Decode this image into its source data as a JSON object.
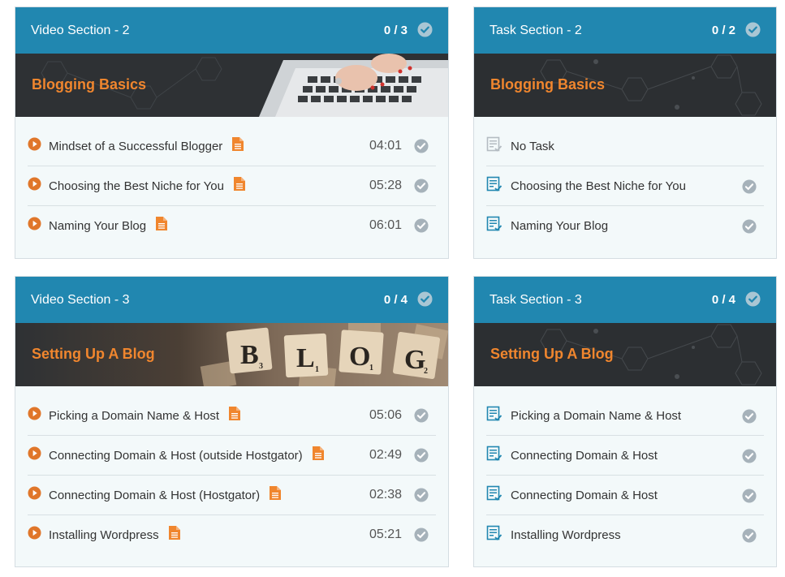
{
  "video_sections": [
    {
      "header_title": "Video Section - 2",
      "progress": "0 / 3",
      "banner_title": "Blogging Basics",
      "lessons": [
        {
          "title": "Mindset of a Successful Blogger",
          "duration": "04:01"
        },
        {
          "title": "Choosing the Best Niche for You",
          "duration": "05:28"
        },
        {
          "title": "Naming Your Blog",
          "duration": "06:01"
        }
      ]
    },
    {
      "header_title": "Video Section - 3",
      "progress": "0 / 4",
      "banner_title": "Setting Up A Blog",
      "lessons": [
        {
          "title": "Picking a Domain Name & Host",
          "duration": "05:06"
        },
        {
          "title": "Connecting Domain & Host (outside Hostgator)",
          "duration": "02:49"
        },
        {
          "title": "Connecting Domain & Host (Hostgator)",
          "duration": "02:38"
        },
        {
          "title": "Installing Wordpress",
          "duration": "05:21"
        }
      ]
    }
  ],
  "task_sections": [
    {
      "header_title": "Task Section - 2",
      "progress": "0 / 2",
      "banner_title": "Blogging Basics",
      "tasks": [
        {
          "title": "No Task"
        },
        {
          "title": "Choosing the Best Niche for You"
        },
        {
          "title": "Naming Your Blog"
        }
      ]
    },
    {
      "header_title": "Task Section - 3",
      "progress": "0 / 4",
      "banner_title": "Setting Up A Blog",
      "tasks": [
        {
          "title": "Picking a Domain Name & Host"
        },
        {
          "title": "Connecting Domain & Host"
        },
        {
          "title": "Connecting Domain & Host"
        },
        {
          "title": "Installing Wordpress"
        }
      ]
    }
  ],
  "banner_tiles": [
    "B",
    "L",
    "O",
    "G"
  ],
  "banner_tile_subscripts": [
    "3",
    "1",
    "1",
    "2"
  ],
  "colors": {
    "header_bg": "#2187b0",
    "accent_orange": "#f0862e",
    "play_orange": "#e0762a",
    "task_icon_blue": "#2187b0",
    "check_grey": "#a6b2ba",
    "card_bg": "#f3f9fa"
  },
  "icons": {
    "play": "play-circle-icon",
    "file": "document-icon",
    "check": "check-circle-icon",
    "task": "task-list-icon"
  }
}
